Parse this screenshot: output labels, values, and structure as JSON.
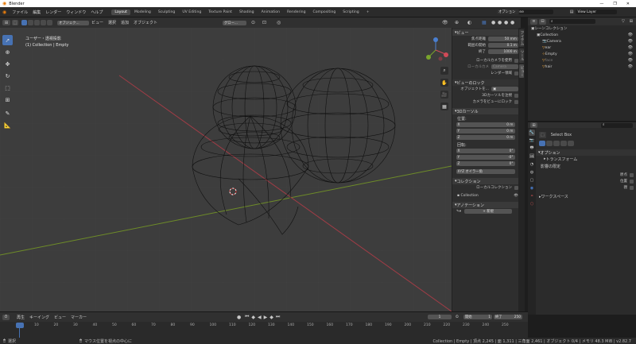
{
  "window": {
    "app_title": "Blender",
    "controls": [
      "—",
      "❐",
      "✕"
    ]
  },
  "menu": [
    "ファイル",
    "編集",
    "レンダー",
    "ウィンドウ",
    "ヘルプ"
  ],
  "workspaces": [
    "Layout",
    "Modeling",
    "Sculpting",
    "UV Editing",
    "Texture Paint",
    "Shading",
    "Animation",
    "Rendering",
    "Compositing",
    "Scripting"
  ],
  "active_workspace": "Layout",
  "scene": {
    "name": "Scene",
    "view_layer": "View Layer"
  },
  "viewport_header": {
    "mode": "オブジェク...",
    "menus": [
      "ビュー",
      "選択",
      "追加",
      "オブジェクト"
    ],
    "transform": "グロー...",
    "options_label": "オプション"
  },
  "viewport_info": {
    "line1": "ユーザー・透視投影",
    "line2": "(1) Collection | Empty"
  },
  "npanel": {
    "view_header": "ビュー",
    "focal_label": "焦点距離",
    "focal_value": "50 mm",
    "clip_label": "範囲の開始",
    "clip_start": "0.1 m",
    "clip_end_label": "終了",
    "clip_end": "1000 m",
    "local_camera": "ローカルカメラを使用",
    "local_camera_sub": "ローカルカメ",
    "camera_value": "Camera",
    "render_region": "レンダー領域",
    "lock_header": "ビューのロック",
    "lock_object": "オブジェクトを...",
    "lock_cursor": "3Dカーソルを注視",
    "lock_camera": "カメラをビューにロック",
    "cursor_header": "3Dカーソル",
    "location": "位置:",
    "x_label": "X",
    "x_val": "0 m",
    "y_label": "Y",
    "y_val": "0 m",
    "z_label": "Z",
    "z_val": "0 m",
    "rotation": "回転:",
    "rx": "0°",
    "ry": "-0°",
    "rz": "0°",
    "rot_mode": "XYZ オイラー角",
    "collection_header": "コレクション",
    "local_collection": "ローカルコレクション",
    "collection_name": "Collection",
    "annotation_header": "アノテーション",
    "new_label": "新規"
  },
  "side_tabs": [
    "アイテム",
    "ツール",
    "ビュー"
  ],
  "outliner": {
    "title": "シーンコレクション",
    "items": [
      {
        "name": "Collection",
        "indent": 1,
        "icon": "collection-icon",
        "color": "#cfcfcf"
      },
      {
        "name": "Camera",
        "indent": 2,
        "icon": "camera-icon",
        "color": "#cfcfcf"
      },
      {
        "name": "ear",
        "indent": 2,
        "icon": "mesh-icon",
        "color": "#cfcfcf"
      },
      {
        "name": "Empty",
        "indent": 2,
        "icon": "empty-icon",
        "color": "#cfcfcf"
      },
      {
        "name": "face",
        "indent": 2,
        "icon": "mesh-icon",
        "color": "#777777"
      },
      {
        "name": "hair",
        "indent": 2,
        "icon": "mesh-icon",
        "color": "#cfcfcf"
      }
    ]
  },
  "properties": {
    "tool_name": "Select Box",
    "options": "オプション",
    "transform": "トランスフォーム",
    "affect_only": "影響の限定",
    "origin": "原点",
    "location": "位置",
    "parent": "親",
    "workspace": "ワークスペース"
  },
  "timeline": {
    "menus": [
      "再生",
      "キーイング",
      "ビュー",
      "マーカー"
    ],
    "current_frame": "1",
    "start_label": "開始",
    "start": "1",
    "end_label": "終了",
    "end": "250",
    "ticks": [
      "1",
      "10",
      "20",
      "30",
      "40",
      "50",
      "60",
      "70",
      "80",
      "90",
      "100",
      "110",
      "120",
      "130",
      "140",
      "150",
      "160",
      "170",
      "180",
      "190",
      "200",
      "210",
      "220",
      "230",
      "240",
      "250"
    ]
  },
  "statusbar": {
    "select": "選択",
    "center": "マウス位置を視点の中心に",
    "stats": "Collection | Empty | 頂点 2,245 | 面 1,311 | 三角面 2,461 | オブジェクト 0/4 | メモリ 48.3 MiB | v2.82.7"
  },
  "colors": {
    "accent": "#4772b3",
    "x_axis": "#a03c46",
    "y_axis": "#6e8c28"
  }
}
